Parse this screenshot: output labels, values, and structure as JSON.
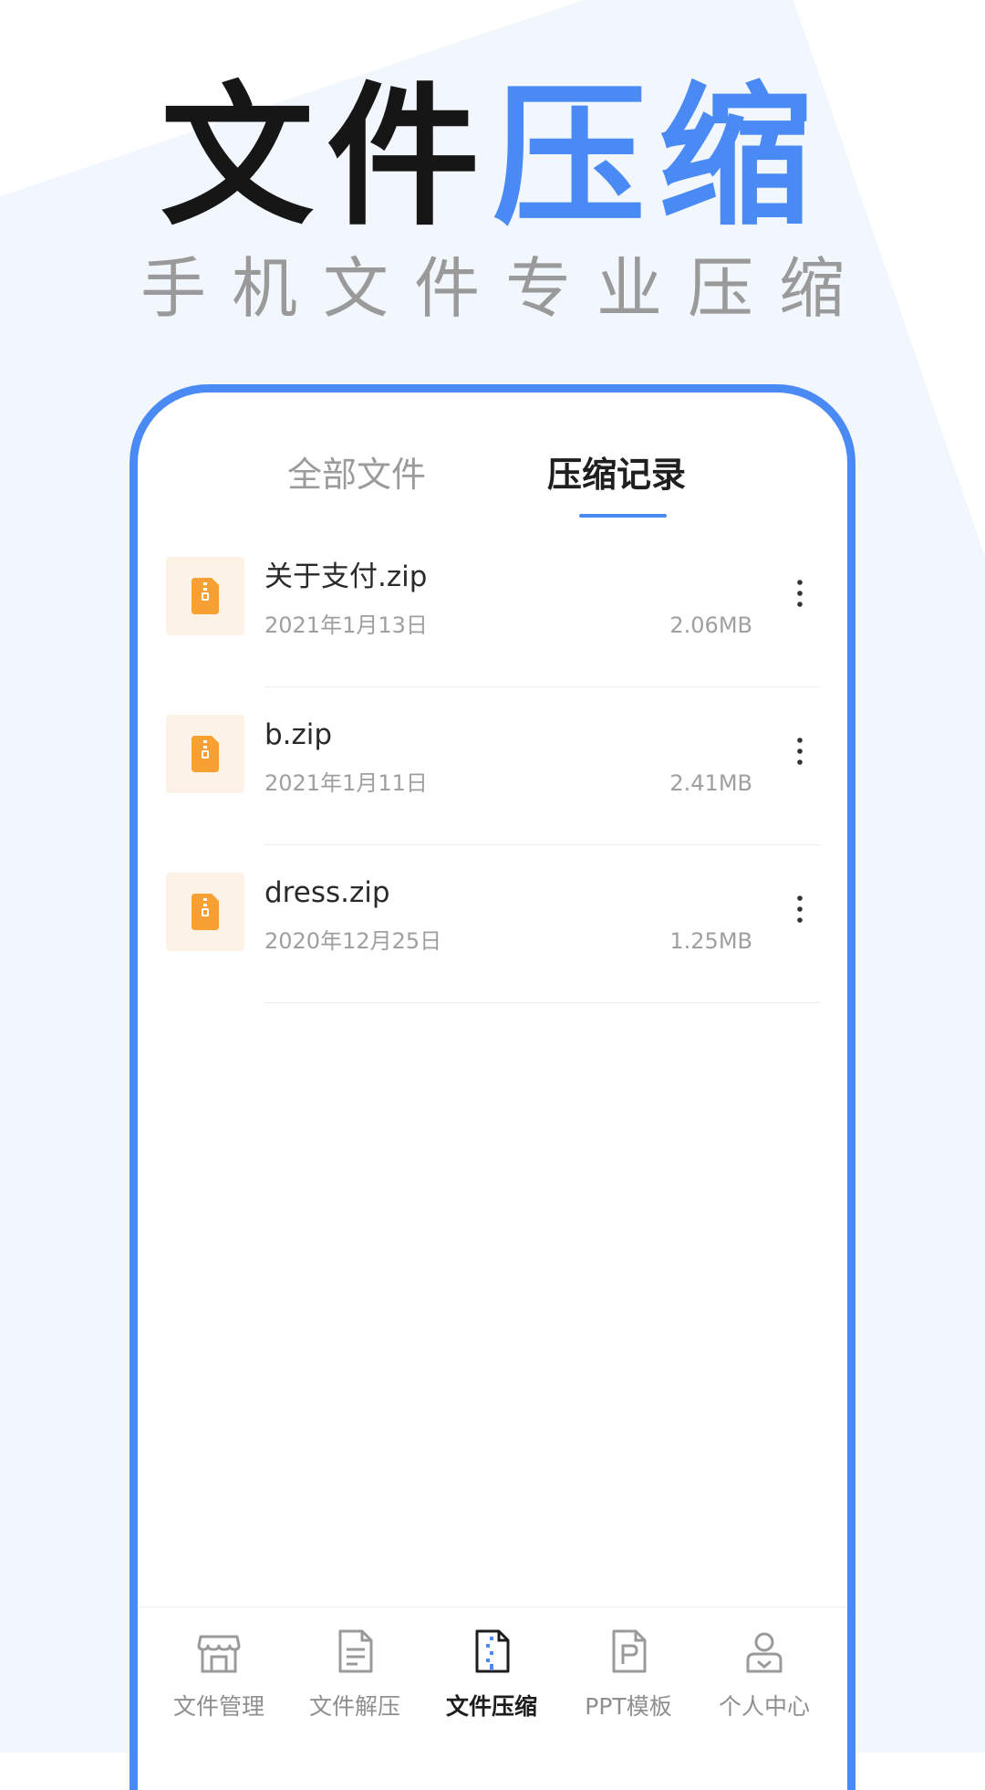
{
  "headline": {
    "part1": "文件",
    "part2": "压缩"
  },
  "subheadline": "手机文件专业压缩",
  "tabs": [
    {
      "label": "全部文件",
      "active": false
    },
    {
      "label": "压缩记录",
      "active": true
    }
  ],
  "files": [
    {
      "name": "关于支付.zip",
      "date": "2021年1月13日",
      "size": "2.06MB",
      "icon": "zip-file-icon"
    },
    {
      "name": "b.zip",
      "date": "2021年1月11日",
      "size": "2.41MB",
      "icon": "zip-file-icon"
    },
    {
      "name": "dress.zip",
      "date": "2020年12月25日",
      "size": "1.25MB",
      "icon": "zip-file-icon"
    }
  ],
  "nav": [
    {
      "label": "文件管理",
      "icon": "storefront-icon",
      "active": false
    },
    {
      "label": "文件解压",
      "icon": "document-icon",
      "active": false
    },
    {
      "label": "文件压缩",
      "icon": "zip-document-icon",
      "active": true
    },
    {
      "label": "PPT模板",
      "icon": "ppt-icon",
      "active": false
    },
    {
      "label": "个人中心",
      "icon": "user-icon",
      "active": false
    }
  ],
  "colors": {
    "accent": "#4a8af4",
    "zip_orange": "#f7a033",
    "zip_tile_bg": "#fdf2e6",
    "page_bg_shape": "#f2f7fd"
  }
}
